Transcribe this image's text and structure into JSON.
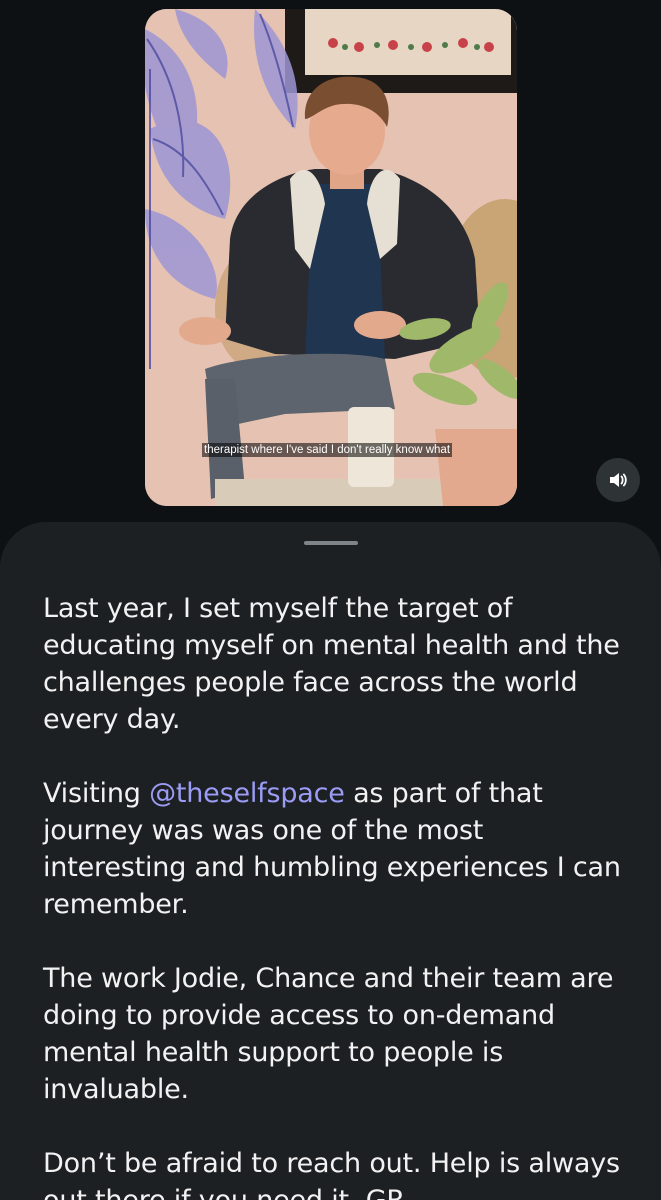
{
  "video": {
    "caption": "therapist where I've said I don't really know what",
    "sound_icon": "speaker-volume-icon"
  },
  "post": {
    "p1": "Last year, I set myself the target of educating myself on mental health and the challenges people face across the world every day.",
    "p2_before": "Visiting ",
    "p2_mention": "@theselfspace",
    "p2_after": " as part of that journey was was one of the most interesting and humbling experiences I can remember.",
    "p3": "The work Jodie, Chance and their team are doing to provide access to on-demand mental health support to people is invaluable.",
    "p4": "Don’t be afraid to reach out. Help is always out there if you need it. GR."
  },
  "colors": {
    "background": "#0d1114",
    "sheet": "#1d2023",
    "text": "#f2f2f2",
    "mention": "#9b9cf5"
  }
}
